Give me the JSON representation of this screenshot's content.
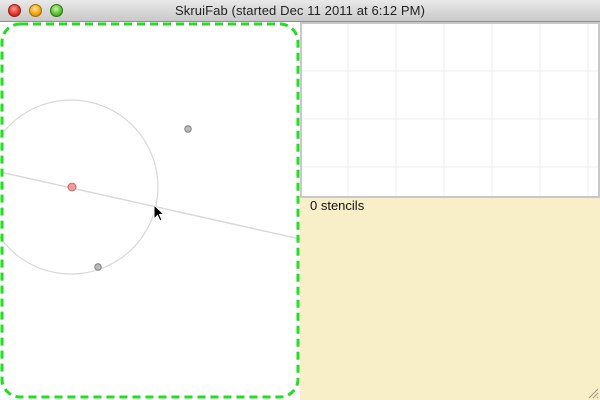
{
  "window": {
    "title": "SkruiFab (started Dec 11 2011 at 6:12 PM)",
    "controls": [
      "close-button",
      "minimize-button",
      "zoom-button"
    ]
  },
  "canvas": {
    "selection_color": "#22dd22",
    "construction_line_color": "#d9d9d9",
    "control_points": [
      {
        "name": "center-point",
        "color": "#f29a9a"
      },
      {
        "name": "handle-point",
        "color": "#b9b9b9"
      },
      {
        "name": "handle-point",
        "color": "#b9b9b9"
      }
    ]
  },
  "grid": {
    "line_color": "#eeeeee"
  },
  "info": {
    "stencil_count": "0 stencils",
    "background": "#f8efc8"
  },
  "cursor": "arrow-cursor-icon"
}
